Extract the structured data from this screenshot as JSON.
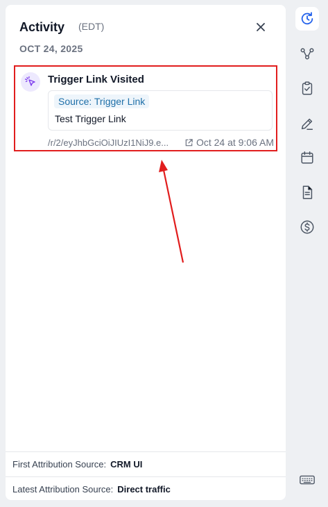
{
  "activity": {
    "title": "Activity",
    "timezone": "(EDT)",
    "date": "OCT 24, 2025"
  },
  "event": {
    "title": "Trigger Link Visited",
    "source_label": "Source: Trigger Link",
    "content": "Test Trigger Link",
    "link": "/r/2/eyJhbGciOiJIUzI1NiJ9.e...",
    "timestamp": "Oct 24 at 9:06 AM",
    "icon": "cursor-click-icon"
  },
  "attribution": {
    "first_label": "First Attribution Source:",
    "first_value": "CRM UI",
    "latest_label": "Latest Attribution Source:",
    "latest_value": "Direct traffic"
  },
  "rail": {
    "items": [
      "activity-clock-icon",
      "workflow-icon",
      "tasks-clipboard-icon",
      "notes-pen-icon",
      "calendar-icon",
      "document-icon",
      "payments-dollar-icon",
      "keyboard-icon"
    ],
    "active": "activity-clock-icon"
  },
  "colors": {
    "highlight": "#e11d1d",
    "accent": "#1e6fa8",
    "active_icon": "#2563eb"
  }
}
